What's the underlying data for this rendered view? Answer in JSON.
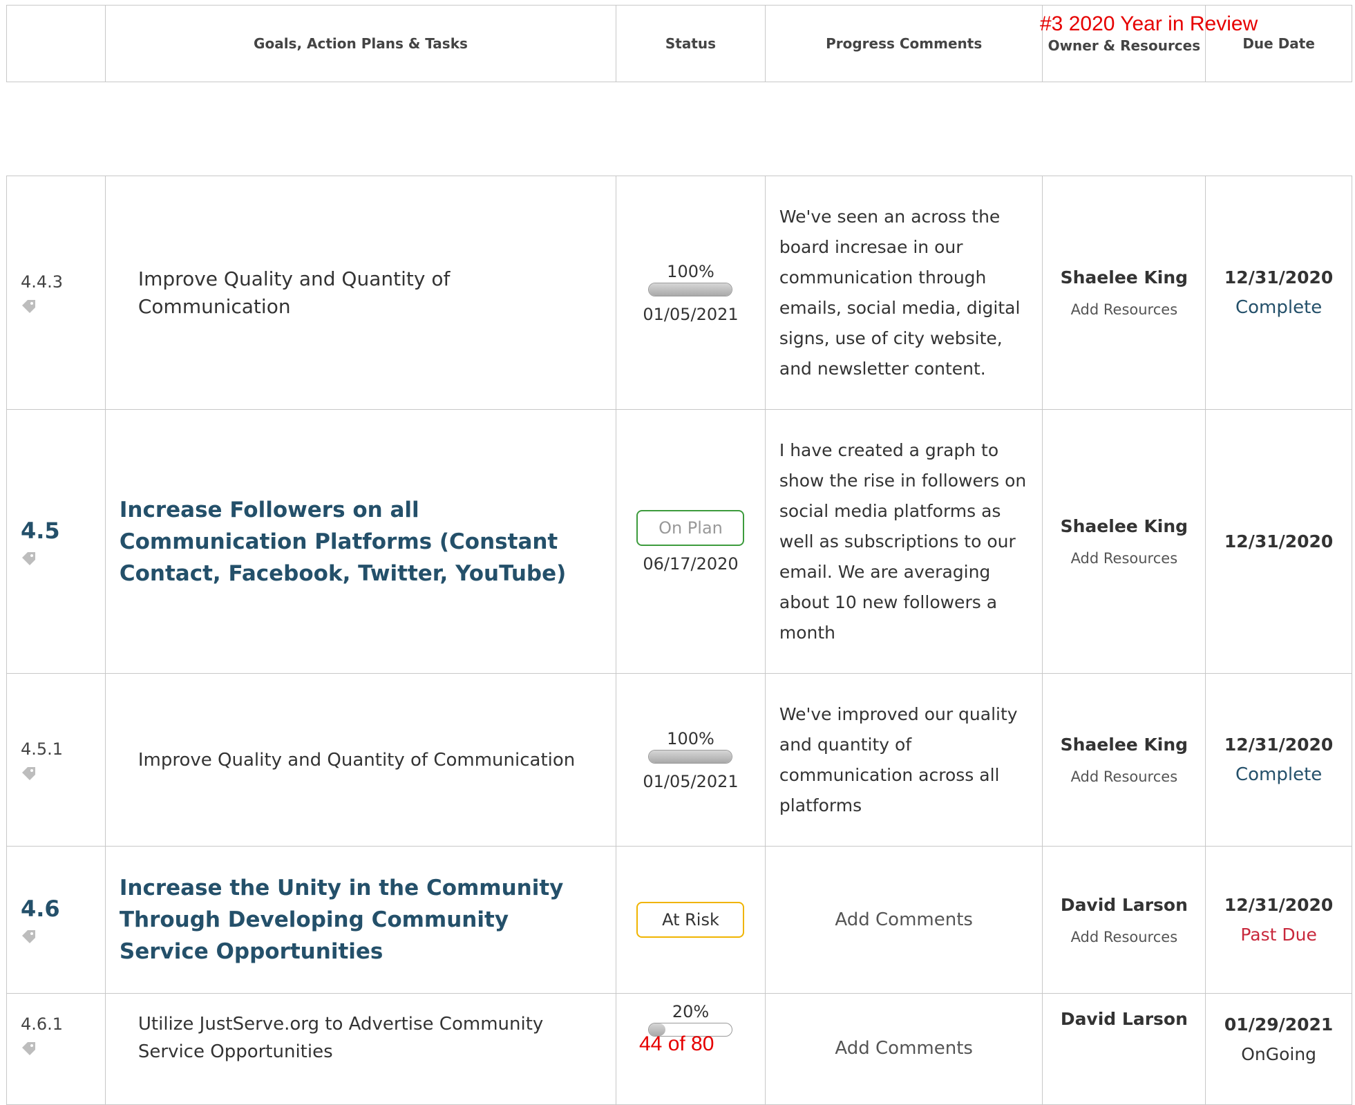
{
  "header": {
    "col_goals": "Goals, Action Plans & Tasks",
    "col_status": "Status",
    "col_progress": "Progress Comments",
    "col_owner": "Owner & Resources",
    "col_due": "Due Date"
  },
  "overlay": {
    "page_title": "#3 2020 Year in Review",
    "page_counter": "44 of 80"
  },
  "rows": [
    {
      "number": "4.4.3",
      "title": "Improve Quality and Quantity of Communication",
      "status_percent": "100%",
      "progress_fraction": 1.0,
      "status_date": "01/05/2021",
      "comment": "We've seen an across the board incresae in our communication through emails, social media, digital signs, use of city website, and newsletter content.",
      "owner": "Shaelee King",
      "resources": "Add Resources",
      "due_date": "12/31/2020",
      "due_state": "Complete"
    },
    {
      "number": "4.5",
      "title": "Increase Followers on all Communication Platforms (Constant Contact, Facebook, Twitter, YouTube)",
      "status_badge": "On Plan",
      "status_date": "06/17/2020",
      "comment": "I have created a graph to show the rise in followers on social media platforms as well as subscriptions to our email. We are averaging about 10 new followers a month",
      "owner": "Shaelee King",
      "resources": "Add Resources",
      "due_date": "12/31/2020"
    },
    {
      "number": "4.5.1",
      "title": "Improve Quality and Quantity of Communication",
      "status_percent": "100%",
      "progress_fraction": 1.0,
      "status_date": "01/05/2021",
      "comment": "We've improved our quality and quantity of communication across all platforms",
      "owner": "Shaelee King",
      "resources": "Add Resources",
      "due_date": "12/31/2020",
      "due_state": "Complete"
    },
    {
      "number": "4.6",
      "title": "Increase the Unity in the Community Through Developing Community Service Opportunities",
      "status_badge": "At Risk",
      "comment": "Add Comments",
      "owner": "David Larson",
      "resources": "Add Resources",
      "due_date": "12/31/2020",
      "due_state": "Past Due"
    },
    {
      "number": "4.6.1",
      "title": "Utilize JustServe.org to Advertise Community Service Opportunities",
      "status_percent": "20%",
      "progress_fraction": 0.2,
      "comment": "Add Comments",
      "owner": "David Larson",
      "due_date": "01/29/2021",
      "due_state": "OnGoing"
    }
  ],
  "colors": {
    "goal_blue": "#24506a",
    "on_plan_border": "#3c9b3c",
    "at_risk_border": "#f0b400",
    "past_due_red": "#c8283c",
    "overlay_red": "#e60000"
  },
  "icons": {
    "tag": "tag-icon"
  }
}
